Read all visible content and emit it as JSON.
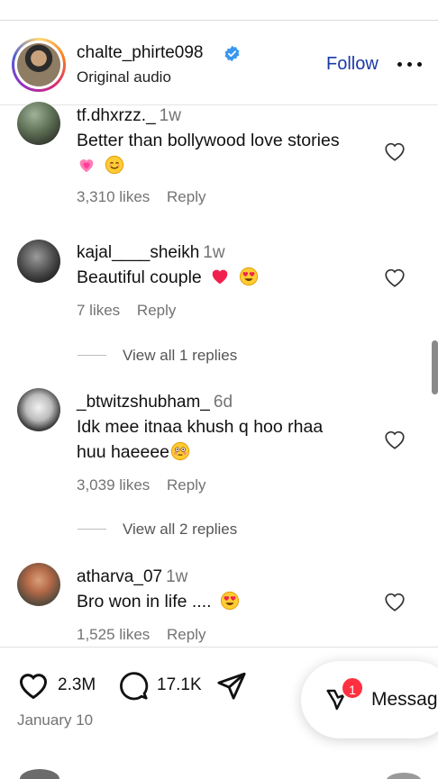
{
  "post": {
    "username": "chalte_phirte098",
    "subtitle": "Original audio",
    "follow_label": "Follow",
    "verified_color": "#3897f0"
  },
  "comments": [
    {
      "user": "tf.dhxrzz._",
      "time": "1w",
      "text_line1": "Better than bollywood love stories",
      "emoji": [
        "pink-heart-emoji",
        "smiling-face-emoji"
      ],
      "likes": "3,310 likes",
      "reply": "Reply"
    },
    {
      "user": "kajal____sheikh",
      "time": "1w",
      "text_line1": "Beautiful couple",
      "emoji": [
        "red-heart-emoji",
        "heart-eyes-emoji"
      ],
      "likes": "7 likes",
      "reply": "Reply",
      "view_replies": "View all 1 replies"
    },
    {
      "user": "_btwitzshubham_",
      "time": "6d",
      "text_line1": "Idk mee itnaa khush q hoo rhaa",
      "text_line2": "huu haeeee",
      "emoji": [
        "flushed-face-emoji"
      ],
      "likes": "3,039 likes",
      "reply": "Reply",
      "view_replies": "View all 2 replies"
    },
    {
      "user": "atharva_07",
      "time": "1w",
      "text_line1": "Bro won in life ....",
      "emoji": [
        "heart-eyes-emoji"
      ],
      "likes": "1,525 likes",
      "reply": "Reply"
    }
  ],
  "actions": {
    "likes_count": "2.3M",
    "comments_count": "17.1K",
    "date": "January 10"
  },
  "messages": {
    "label": "Messag",
    "badge": "1",
    "badge_color": "#ff3040"
  }
}
